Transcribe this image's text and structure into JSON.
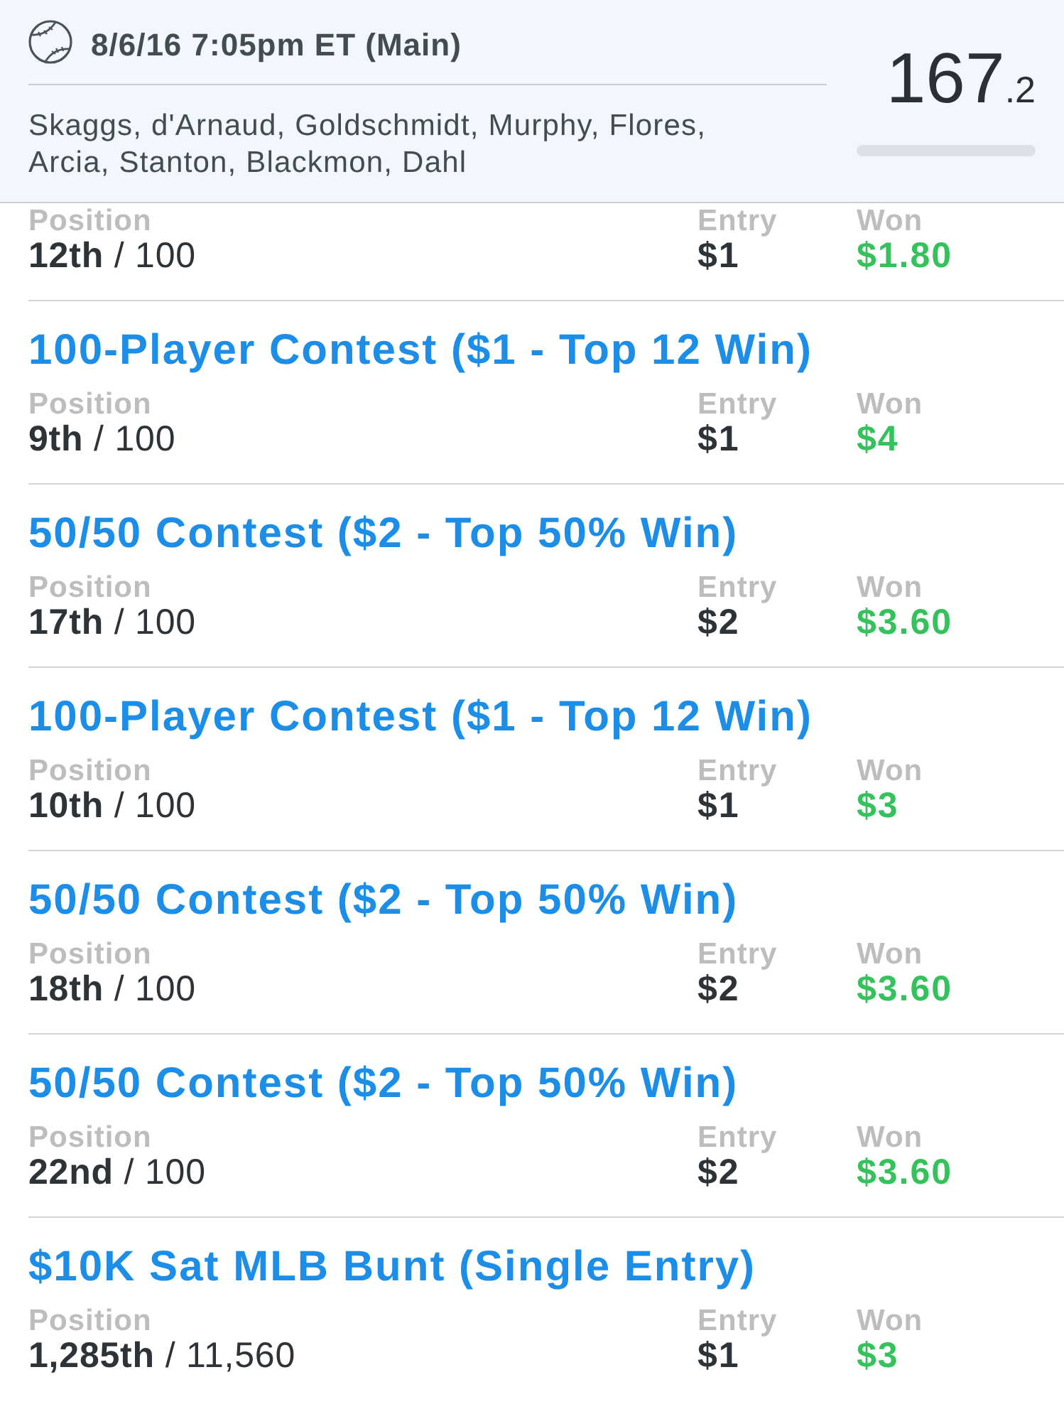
{
  "header": {
    "slate": "8/6/16 7:05pm ET (Main)",
    "players": "Skaggs, d'Arnaud, Goldschmidt, Murphy, Flores, Arcia, Stanton, Blackmon, Dahl",
    "score": "167",
    "score_fraction": ".2"
  },
  "contests": [
    {
      "position_label": "Position",
      "position": "**12th** / 100",
      "entry_label": "Entry",
      "entry": "$1",
      "won_label": "Won",
      "won": "$1.80"
    },
    {
      "title": "100-Player Contest ($1 - Top 12 Win)",
      "position_label": "Position",
      "position": "**9th** / 100",
      "entry_label": "Entry",
      "entry": "$1",
      "won_label": "Won",
      "won": "$4"
    },
    {
      "title": "50/50 Contest ($2 - Top 50% Win)",
      "position_label": "Position",
      "position": "**17th** / 100",
      "entry_label": "Entry",
      "entry": "$2",
      "won_label": "Won",
      "won": "$3.60"
    },
    {
      "title": "100-Player Contest ($1 - Top 12 Win)",
      "position_label": "Position",
      "position": "**10th** / 100",
      "entry_label": "Entry",
      "entry": "$1",
      "won_label": "Won",
      "won": "$3"
    },
    {
      "title": "50/50 Contest ($2 - Top 50% Win)",
      "position_label": "Position",
      "position": "**18th** / 100",
      "entry_label": "Entry",
      "entry": "$2",
      "won_label": "Won",
      "won": "$3.60"
    },
    {
      "title": "50/50 Contest ($2 - Top 50% Win)",
      "position_label": "Position",
      "position": "**22nd** / 100",
      "entry_label": "Entry",
      "entry": "$2",
      "won_label": "Won",
      "won": "$3.60"
    },
    {
      "title": "$10K Sat MLB Bunt (Single Entry)",
      "position_label": "Position",
      "position": "**1,285th** / 11,560",
      "entry_label": "Entry",
      "entry": "$1",
      "won_label": "Won",
      "won": "$3"
    }
  ]
}
